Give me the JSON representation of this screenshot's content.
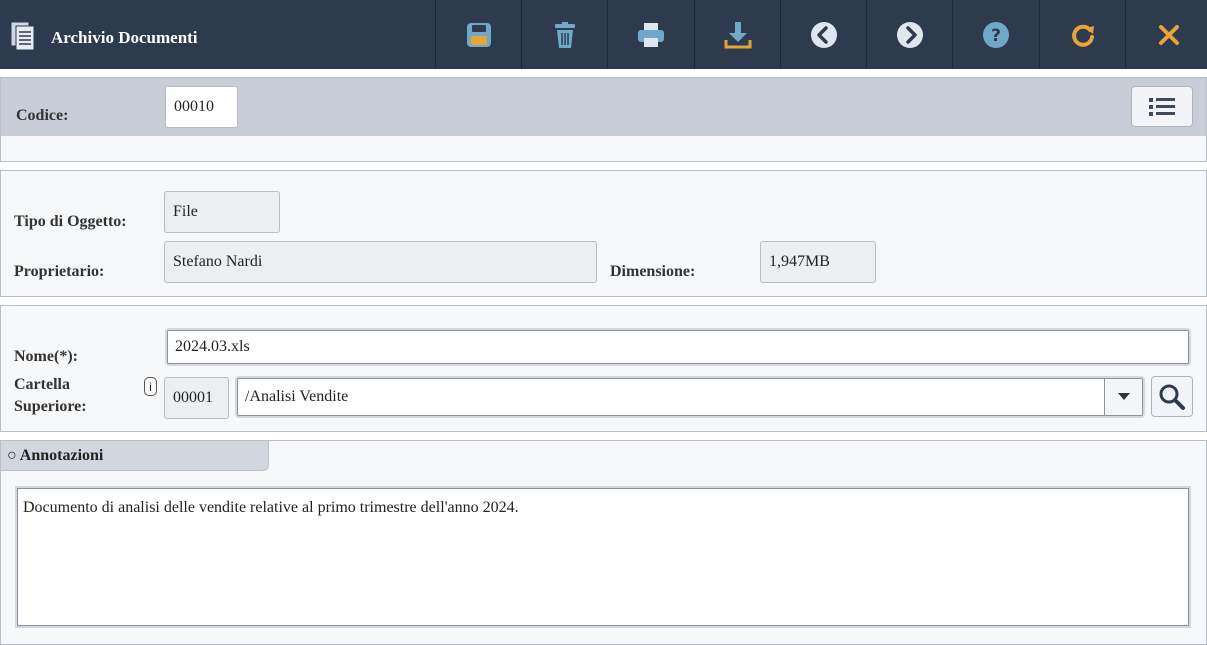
{
  "header": {
    "title": "Archivio Documenti",
    "icons": [
      "save-icon",
      "trash-icon",
      "print-icon",
      "download-icon",
      "previous-icon",
      "next-icon",
      "help-icon",
      "refresh-icon",
      "close-icon"
    ],
    "colors": {
      "bar": "#2e3a4e",
      "icon_blue": "#6fa8c9",
      "icon_orange": "#e8a33a"
    }
  },
  "codice": {
    "label": "Codice:",
    "value": "00010"
  },
  "details": {
    "tipo_label": "Tipo di Oggetto:",
    "tipo_value": "File",
    "proprietario_label": "Proprietario:",
    "proprietario_value": "Stefano Nardi",
    "dimensione_label": "Dimensione:",
    "dimensione_value": "1,947MB"
  },
  "form": {
    "nome_label": "Nome(*):",
    "nome_value": "2024.03.xls",
    "cartella_label_1": "Cartella",
    "cartella_label_2": "Superiore:",
    "info_label": "i",
    "cartella_code": "00001",
    "cartella_path": "/Analisi Vendite"
  },
  "annotazioni": {
    "tab_label": "○ Annotazioni",
    "text": "Documento di analisi delle vendite relative al primo trimestre dell'anno 2024."
  }
}
